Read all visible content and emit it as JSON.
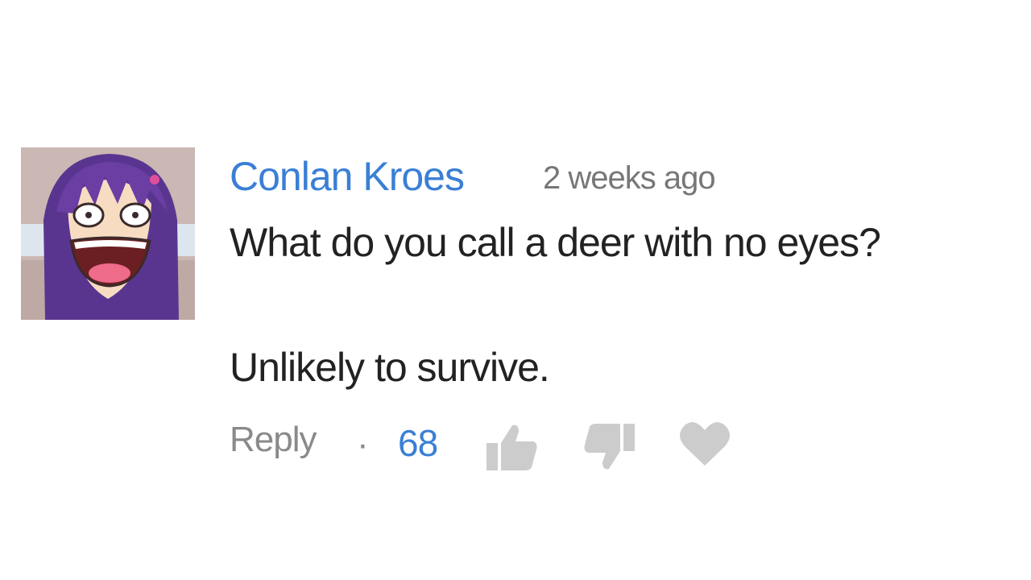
{
  "comment": {
    "author": "Conlan Kroes",
    "timestamp": "2 weeks ago",
    "body_lines": [
      "What do you call a deer with no eyes?",
      "Unlikely to survive."
    ],
    "reply_label": "Reply",
    "separator": "·",
    "like_count": "68"
  },
  "icons": {
    "like": "thumbs-up-icon",
    "dislike": "thumbs-down-icon",
    "heart": "heart-icon"
  },
  "colors": {
    "author": "#3a7fd5",
    "like_count": "#3a7fd5",
    "timestamp": "#777777",
    "body_text": "#222222",
    "actions": "#8a8a8a",
    "icon_gray": "#cccccc"
  }
}
